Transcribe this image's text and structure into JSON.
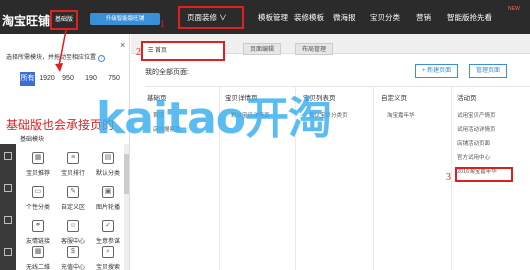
{
  "topbar": {
    "logo": "淘宝旺铺",
    "edition": "基础版",
    "upgrade": "升级智能版旺铺",
    "menu": [
      "页面装修 ∨",
      "模板管理",
      "装修模板",
      "微海报",
      "宝贝分类",
      "营销",
      "智能版抢先看"
    ],
    "badge": "NEW"
  },
  "markers": {
    "m1": "1",
    "m2": "2",
    "m3": "3"
  },
  "left": {
    "close": "×",
    "hint": "选择所需模块，并拖动至相应位置",
    "help": "?",
    "widths": [
      "所有",
      "1920",
      "950",
      "190",
      "750"
    ],
    "note": "基础版也会承接页的",
    "section": "基础模块",
    "modules": [
      {
        "icon": "▦",
        "label": "宝贝推荐"
      },
      {
        "icon": "≡",
        "label": "宝贝排行"
      },
      {
        "icon": "▤",
        "label": "默认分类"
      },
      {
        "icon": "▭",
        "label": "个性分类"
      },
      {
        "icon": "✎",
        "label": "自定义区"
      },
      {
        "icon": "▣",
        "label": "图片轮播"
      },
      {
        "icon": "⚭",
        "label": "友情链接"
      },
      {
        "icon": "☺",
        "label": "客服中心"
      },
      {
        "icon": "✓",
        "label": "生意参谋"
      },
      {
        "icon": "▩",
        "label": "无线二维"
      },
      {
        "icon": "$",
        "label": "充值中心"
      },
      {
        "icon": "⌕",
        "label": "宝贝搜索"
      }
    ]
  },
  "right": {
    "page_select": "☰ 首页",
    "tabs": [
      "页面编辑",
      "布局管理"
    ],
    "all_pages": "我的全部页面:",
    "new_page": "+ 新建页面",
    "manage_page": "管理页面",
    "columns": [
      {
        "header": "基础页",
        "items": [
          "首页",
          "店内搜索页"
        ]
      },
      {
        "header": "宝贝详情页",
        "items": [
          "默认宝贝详情页"
        ]
      },
      {
        "header": "宝贝列表页",
        "items": [
          "默认宝贝分类页"
        ]
      },
      {
        "header": "自定义页",
        "items": [
          "淘宝嘉年华"
        ]
      },
      {
        "header": "活动页",
        "items": [
          "试用宝贝产情页",
          "试用活动详情页",
          "店铺活动页面",
          "官方试用中心",
          "2016淘宝嘉年华"
        ]
      }
    ]
  },
  "watermark": "kaitao开淘",
  "colors": {
    "topbar": "#2b2b2b",
    "accent": "#3b8fd8",
    "marker": "#e02020",
    "watermark": "#38aef0"
  }
}
